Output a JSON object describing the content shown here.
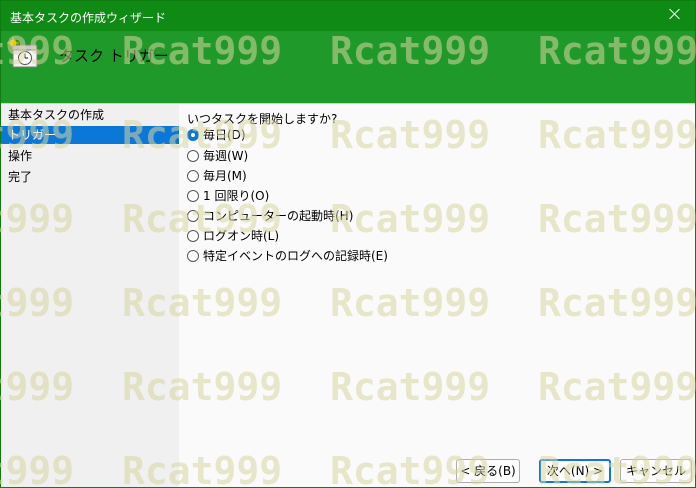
{
  "window": {
    "title": "基本タスクの作成ウィザード"
  },
  "header": {
    "title": "タスク トリガー",
    "icon": "calendar-clock-icon"
  },
  "steps": [
    {
      "label": "基本タスクの作成"
    },
    {
      "label": "トリガー"
    },
    {
      "label": "操作"
    },
    {
      "label": "完了"
    }
  ],
  "main": {
    "question": "いつタスクを開始しますか?",
    "options": [
      {
        "label": "毎日(D)",
        "selected": true
      },
      {
        "label": "毎週(W)",
        "selected": false
      },
      {
        "label": "毎月(M)",
        "selected": false
      },
      {
        "label": "1 回限り(O)",
        "selected": false
      },
      {
        "label": "コンピューターの起動時(H)",
        "selected": false
      },
      {
        "label": "ログオン時(L)",
        "selected": false
      },
      {
        "label": "特定イベントのログへの記録時(E)",
        "selected": false
      }
    ]
  },
  "buttons": {
    "back": "< 戻る(B)",
    "next": "次へ(N) >",
    "cancel": "キャンセル"
  },
  "watermark": {
    "text": "Rcat999",
    "color": "#d8d6a0"
  },
  "colors": {
    "titlebar": "#0f8a14",
    "header": "#1f9a2a",
    "selection": "#0b78d7"
  }
}
